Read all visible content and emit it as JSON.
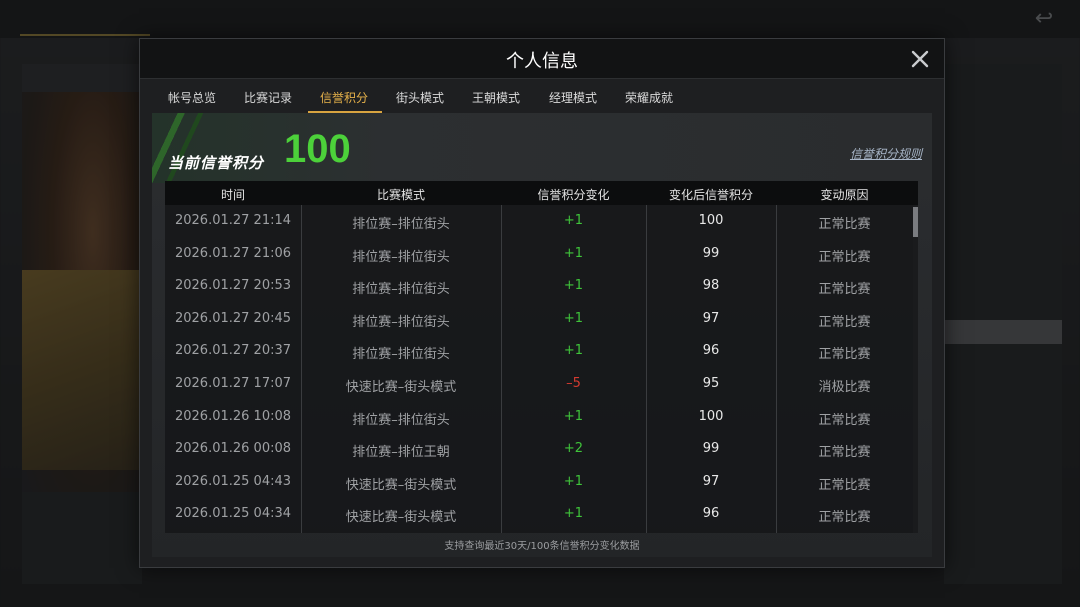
{
  "modal": {
    "title": "个人信息"
  },
  "tabs": [
    {
      "label": "帐号总览"
    },
    {
      "label": "比赛记录"
    },
    {
      "label": "信誉积分",
      "active": true
    },
    {
      "label": "街头模式"
    },
    {
      "label": "王朝模式"
    },
    {
      "label": "经理模式"
    },
    {
      "label": "荣耀成就"
    }
  ],
  "credit": {
    "label": "当前信誉积分",
    "value": "100",
    "rules_link": "信誉积分规则"
  },
  "table": {
    "headers": [
      "时间",
      "比赛模式",
      "信誉积分变化",
      "变化后信誉积分",
      "变动原因"
    ],
    "rows": [
      {
        "time": "2026.01.27  21:14",
        "mode": "排位赛–排位街头",
        "change": "+1",
        "after": "100",
        "reason": "正常比赛"
      },
      {
        "time": "2026.01.27  21:06",
        "mode": "排位赛–排位街头",
        "change": "+1",
        "after": "99",
        "reason": "正常比赛"
      },
      {
        "time": "2026.01.27  20:53",
        "mode": "排位赛–排位街头",
        "change": "+1",
        "after": "98",
        "reason": "正常比赛"
      },
      {
        "time": "2026.01.27  20:45",
        "mode": "排位赛–排位街头",
        "change": "+1",
        "after": "97",
        "reason": "正常比赛"
      },
      {
        "time": "2026.01.27  20:37",
        "mode": "排位赛–排位街头",
        "change": "+1",
        "after": "96",
        "reason": "正常比赛"
      },
      {
        "time": "2026.01.27  17:07",
        "mode": "快速比赛–街头模式",
        "change": "–5",
        "after": "95",
        "reason": "消极比赛"
      },
      {
        "time": "2026.01.26  10:08",
        "mode": "排位赛–排位街头",
        "change": "+1",
        "after": "100",
        "reason": "正常比赛"
      },
      {
        "time": "2026.01.26  00:08",
        "mode": "排位赛–排位王朝",
        "change": "+2",
        "after": "99",
        "reason": "正常比赛"
      },
      {
        "time": "2026.01.25  04:43",
        "mode": "快速比赛–街头模式",
        "change": "+1",
        "after": "97",
        "reason": "正常比赛"
      },
      {
        "time": "2026.01.25  04:34",
        "mode": "快速比赛–街头模式",
        "change": "+1",
        "after": "96",
        "reason": "正常比赛"
      }
    ]
  },
  "footer_note": "支持查询最近30天/100条信誉积分变化数据",
  "colors": {
    "accent_gold": "#e7b24a",
    "credit_green": "#4cd13a",
    "positive": "#3fc33a",
    "negative": "#d23a30"
  },
  "icons": {
    "close": "close-icon",
    "back": "back-arrow-icon"
  }
}
